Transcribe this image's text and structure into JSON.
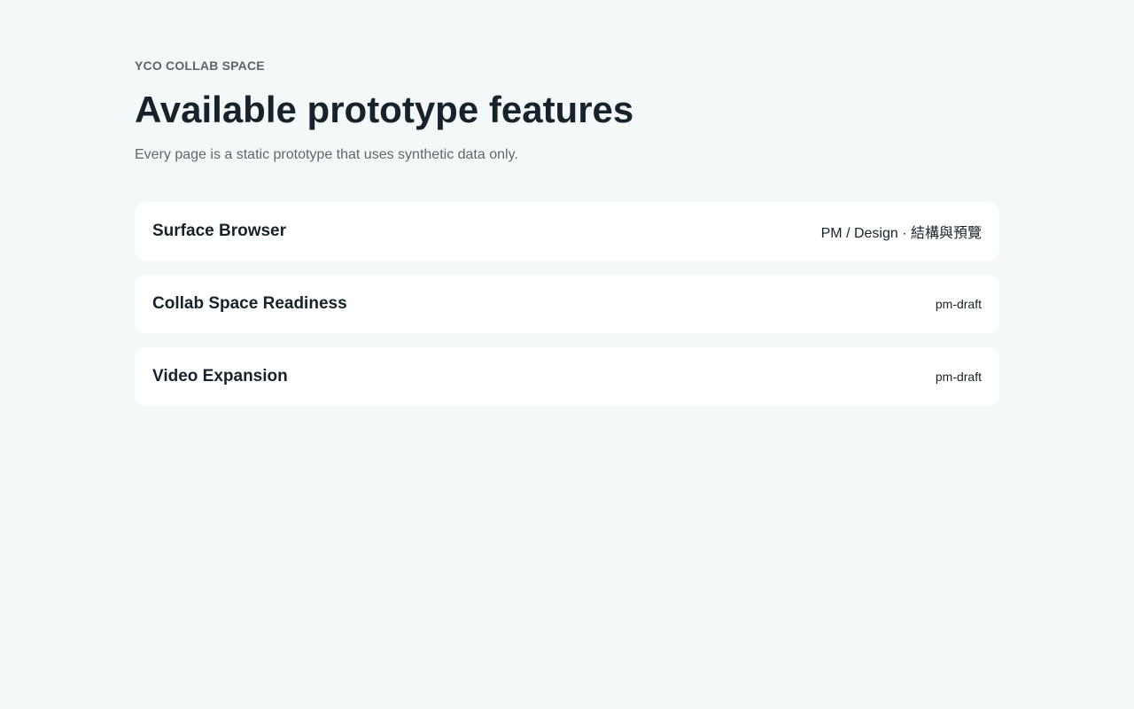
{
  "header": {
    "eyebrow": "YCO COLLAB SPACE",
    "title": "Available prototype features",
    "subtitle": "Every page is a static prototype that uses synthetic data only."
  },
  "features": [
    {
      "name": "Surface Browser",
      "tag": "PM / Design · 結構與預覽"
    },
    {
      "name": "Collab Space Readiness",
      "tag": "pm-draft"
    },
    {
      "name": "Video Expansion",
      "tag": "pm-draft"
    }
  ]
}
